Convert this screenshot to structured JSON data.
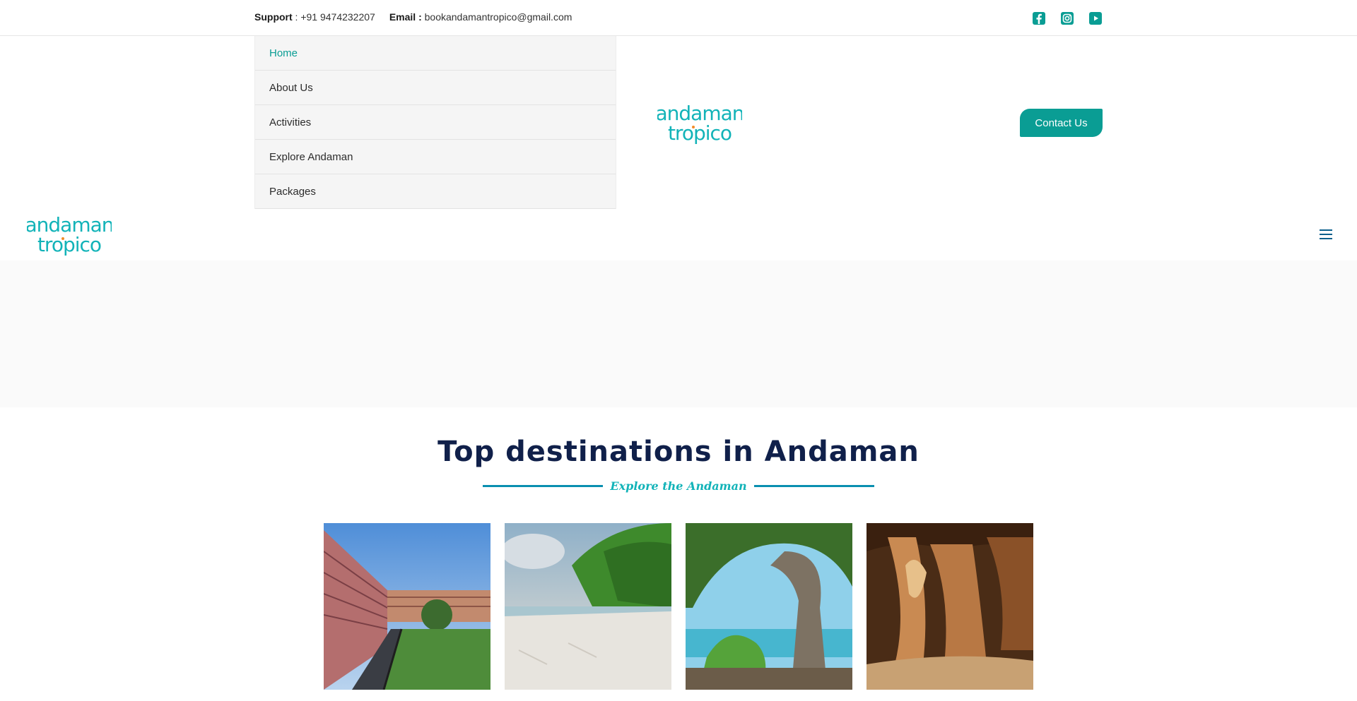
{
  "topbar": {
    "support_label": "Support",
    "support_value": " : +91 9474232207",
    "email_label": "Email :",
    "email_value": " bookandamantropico@gmail.com",
    "social": [
      "facebook-icon",
      "instagram-icon",
      "youtube-icon"
    ]
  },
  "menu": {
    "items": [
      {
        "label": "Home",
        "active": true
      },
      {
        "label": "About Us"
      },
      {
        "label": "Activities"
      },
      {
        "label": "Explore Andaman"
      },
      {
        "label": "Packages"
      }
    ]
  },
  "logo": {
    "line1": "andaman",
    "line2": "tropico"
  },
  "header": {
    "contact_button": "Contact Us"
  },
  "destinations": {
    "title": "Top destinations in Andaman",
    "subtitle": "Explore the Andaman",
    "cards": [
      "cellular-jail-photo",
      "beach-photo",
      "rock-arch-photo",
      "limestone-cave-photo"
    ]
  },
  "colors": {
    "accent": "#0a9d94",
    "title": "#10204a",
    "subtitle": "#12b3b8",
    "divider": "#0a8fb0"
  }
}
